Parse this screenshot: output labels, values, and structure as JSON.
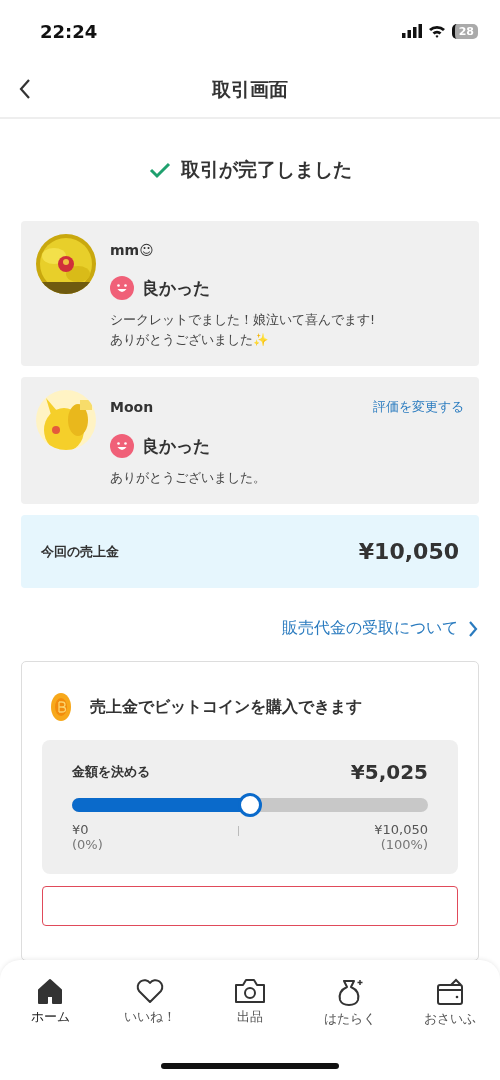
{
  "status_bar": {
    "time": "22:24",
    "battery": "28"
  },
  "nav": {
    "title": "取引画面"
  },
  "completion": {
    "text": "取引が完了しました"
  },
  "reviews": [
    {
      "user": "mm☺",
      "rating": "良かった",
      "comment": "シークレットでました！娘泣いて喜んでます!\nありがとうございました✨"
    },
    {
      "user": "Moon",
      "rating": "良かった",
      "comment": "ありがとうございました。",
      "action": "評価を変更する"
    }
  ],
  "sales": {
    "label": "今回の売上金",
    "amount": "¥10,050"
  },
  "link": {
    "text": "販売代金の受取について"
  },
  "bitcoin": {
    "title": "売上金でビットコインを購入できます",
    "slider": {
      "label": "金額を決める",
      "value": "¥5,025",
      "level": 0.5,
      "min": "¥0",
      "min_pct": "(0%)",
      "max": "¥10,050",
      "max_pct": "(100%)"
    }
  },
  "tabs": [
    {
      "kind": "home",
      "label": "ホーム",
      "selected": true
    },
    {
      "kind": "heart",
      "label": "いいね！",
      "selected": false
    },
    {
      "kind": "camera",
      "label": "出品",
      "selected": false
    },
    {
      "kind": "bag",
      "label": "はたらく",
      "selected": false
    },
    {
      "kind": "wallet",
      "label": "おさいふ",
      "selected": false
    }
  ]
}
